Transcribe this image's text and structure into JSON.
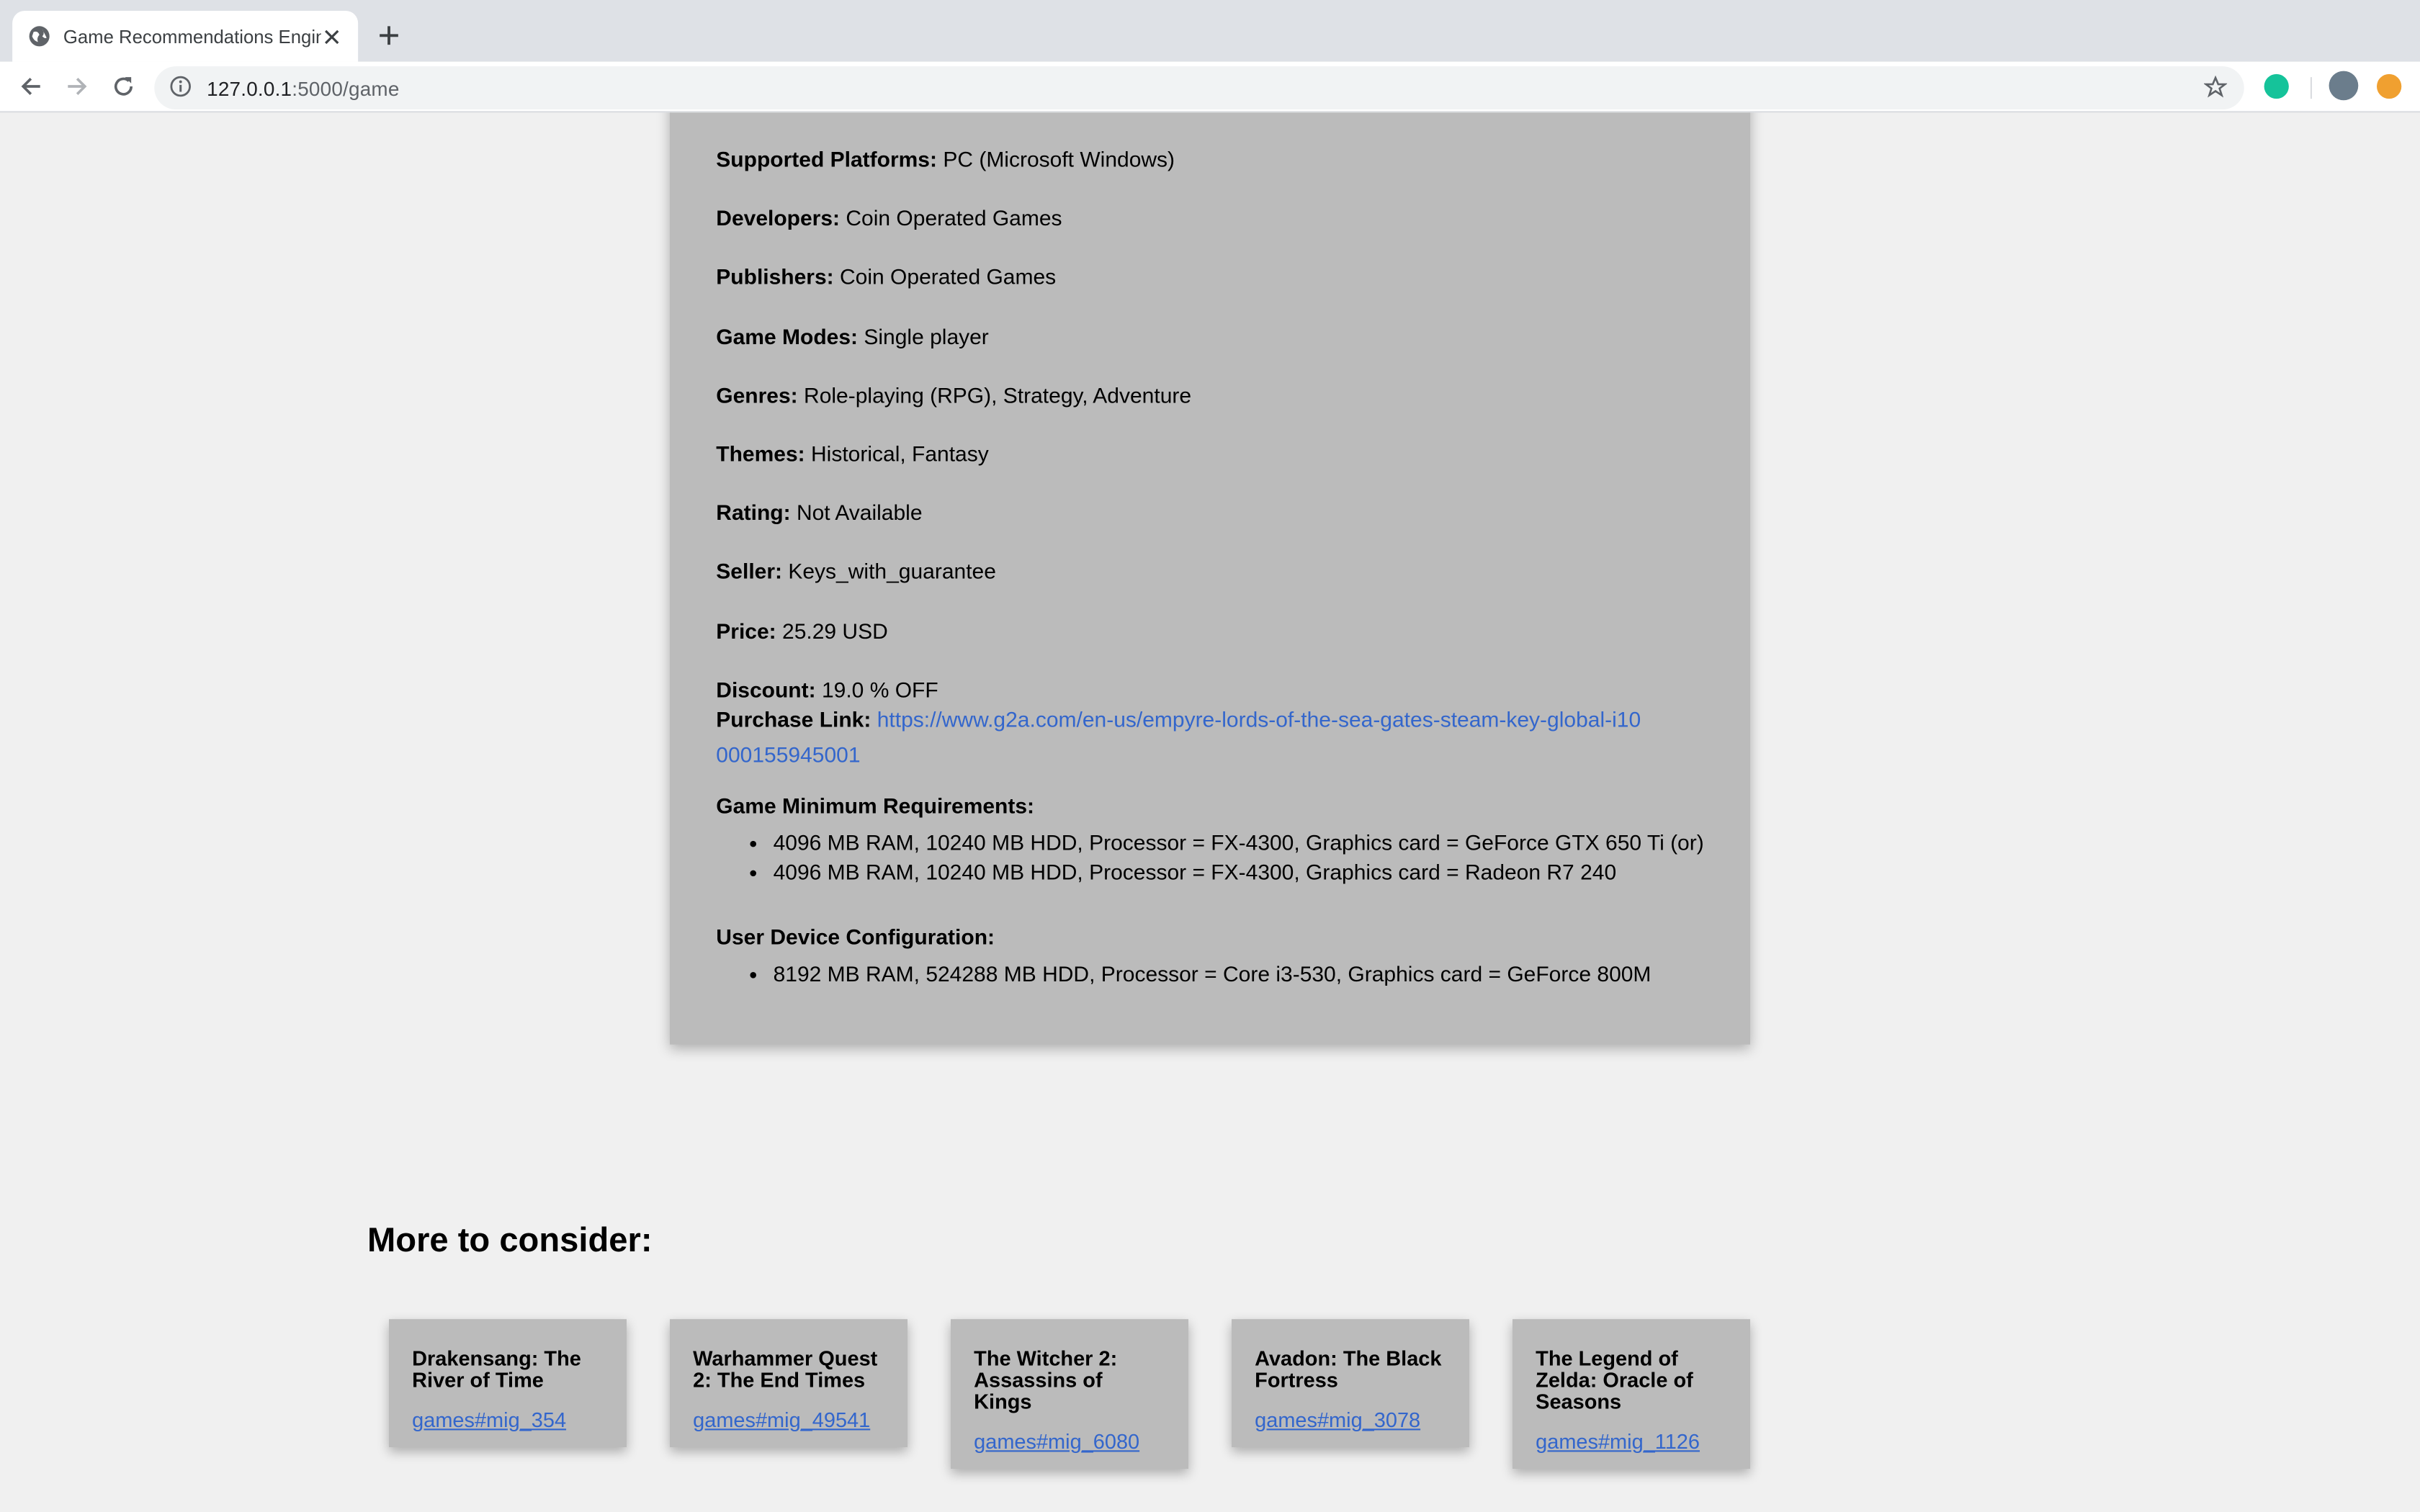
{
  "browser": {
    "tab_title": "Game Recommendations Engine",
    "url_host": "127.0.0.1",
    "url_port_path": ":5000/game"
  },
  "game": {
    "fields": [
      {
        "label": "Supported Platforms:",
        "value": "PC (Microsoft Windows)"
      },
      {
        "label": "Developers:",
        "value": "Coin Operated Games"
      },
      {
        "label": "Publishers:",
        "value": "Coin Operated Games"
      },
      {
        "label": "Game Modes:",
        "value": "Single player"
      },
      {
        "label": "Genres:",
        "value": "Role-playing (RPG), Strategy, Adventure"
      },
      {
        "label": "Themes:",
        "value": "Historical, Fantasy"
      },
      {
        "label": "Rating:",
        "value": "Not Available"
      },
      {
        "label": "Seller:",
        "value": "Keys_with_guarantee"
      },
      {
        "label": "Price:",
        "value": "25.29 USD"
      },
      {
        "label": "Discount:",
        "value": "19.0 % OFF"
      }
    ],
    "purchase_label": "Purchase Link:",
    "purchase_url": "https://www.g2a.com/en-us/empyre-lords-of-the-sea-gates-steam-key-global-i10000155945001",
    "min_req_label": "Game Minimum Requirements:",
    "min_requirements": [
      "4096 MB RAM, 10240 MB HDD, Processor = FX-4300, Graphics card = GeForce GTX 650 Ti (or)",
      "4096 MB RAM, 10240 MB HDD, Processor = FX-4300, Graphics card = Radeon R7 240"
    ],
    "user_config_label": "User Device Configuration:",
    "user_config": [
      "8192 MB RAM, 524288 MB HDD, Processor = Core i3-530, Graphics card = GeForce 800M"
    ]
  },
  "more": {
    "title": "More to consider:",
    "items": [
      {
        "title": "Drakensang: The River of Time",
        "link": "games#mig_354"
      },
      {
        "title": "Warhammer Quest 2: The End Times",
        "link": "games#mig_49541"
      },
      {
        "title": "The Witcher 2: Assassins of Kings",
        "link": "games#mig_6080"
      },
      {
        "title": "Avadon: The Black Fortress",
        "link": "games#mig_3078"
      },
      {
        "title": "The Legend of Zelda: Oracle of Seasons",
        "link": "games#mig_1126"
      }
    ]
  },
  "colors": {
    "link": "#3366cc",
    "card": "#bbbbbb",
    "page": "#f0f0f0"
  }
}
